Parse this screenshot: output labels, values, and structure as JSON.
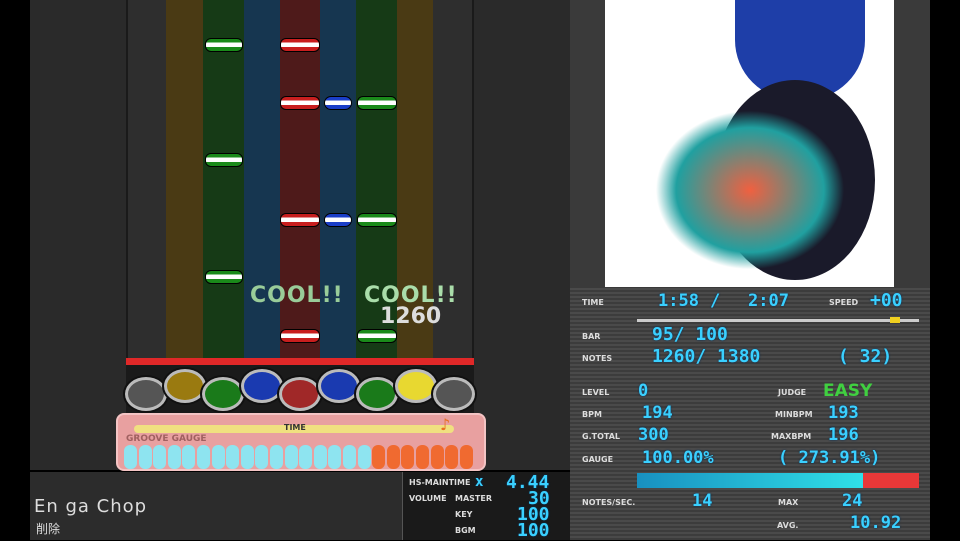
{
  "judgments": [
    {
      "text": "COOL!!"
    },
    {
      "text": "COOL!!"
    }
  ],
  "combo": "1260",
  "gauge": {
    "time_label": "TIME",
    "groove_label": "GROOVE GAUGE",
    "segments_total": 24,
    "segments_filled_blue": 17
  },
  "song": {
    "title": "En ga Chop",
    "subtitle": "削除"
  },
  "volume": {
    "hs_label": "HS-MAINTIME",
    "hs_x": "x",
    "hs_value": "4.44",
    "volume_label": "VOLUME",
    "master_label": "MASTER",
    "master": "30",
    "key_label": "KEY",
    "key": "100",
    "bgm_label": "BGM",
    "bgm": "100"
  },
  "stats": {
    "time_label": "TIME",
    "time_current": "1:58",
    "time_total": "2:07",
    "speed_label": "SPEED",
    "speed": "+00",
    "time_progress": 0.93,
    "bar_label": "BAR",
    "bar": "95/ 100",
    "notes_label": "NOTES",
    "notes": "1260/ 1380",
    "notes_extra": "( 32)",
    "level_label": "LEVEL",
    "level": "0",
    "judge_label": "JUDGE",
    "judge": "EASY",
    "bpm_label": "BPM",
    "bpm": "194",
    "minbpm_label": "MINBPM",
    "minbpm": "193",
    "gtotal_label": "G.TOTAL",
    "gtotal": "300",
    "maxbpm_label": "MAXBPM",
    "maxbpm": "196",
    "gauge_label": "GAUGE",
    "gauge": "100.00%",
    "gauge_extra": "( 273.91%)",
    "gauge_fill": 0.8,
    "nps_label": "NOTES/SEC.",
    "nps": "14",
    "max_label": "MAX",
    "max": "24",
    "avg_label": "AVG.",
    "avg": "10.92"
  },
  "colors": {
    "red": "#e02828",
    "blue": "#3ad0ff",
    "green": "#40d040"
  }
}
